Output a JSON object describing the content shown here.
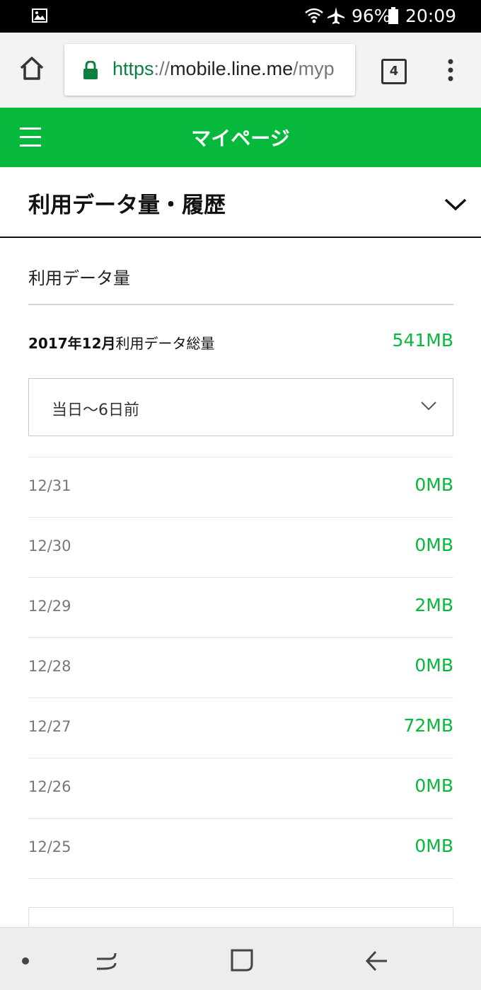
{
  "status_bar": {
    "battery": "96%",
    "time": "20:09"
  },
  "browser": {
    "url_scheme": "https",
    "url_sep": "://",
    "url_host": "mobile.line.me",
    "url_path": "/myp",
    "tab_count": "4"
  },
  "header": {
    "title": "マイページ"
  },
  "section": {
    "title": "利用データ量・履歴"
  },
  "usage": {
    "subtitle": "利用データ量",
    "total_period": "2017年12月",
    "total_label": "利用データ総量",
    "total_value": "541MB",
    "range_selected": "当日〜6日前",
    "rows": [
      {
        "date": "12/31",
        "value": "0MB"
      },
      {
        "date": "12/30",
        "value": "0MB"
      },
      {
        "date": "12/29",
        "value": "2MB"
      },
      {
        "date": "12/28",
        "value": "0MB"
      },
      {
        "date": "12/27",
        "value": "72MB"
      },
      {
        "date": "12/26",
        "value": "0MB"
      },
      {
        "date": "12/25",
        "value": "0MB"
      }
    ]
  },
  "colors": {
    "brand_green": "#06b83b",
    "url_green": "#0b8043"
  },
  "icons": [
    "gallery-icon",
    "wifi-icon",
    "airplane-icon",
    "battery-icon",
    "home-icon",
    "lock-icon",
    "tabs-icon",
    "more-vert-icon",
    "hamburger-icon",
    "chevron-down-icon",
    "recent-apps-icon",
    "home-key-icon",
    "back-icon"
  ]
}
